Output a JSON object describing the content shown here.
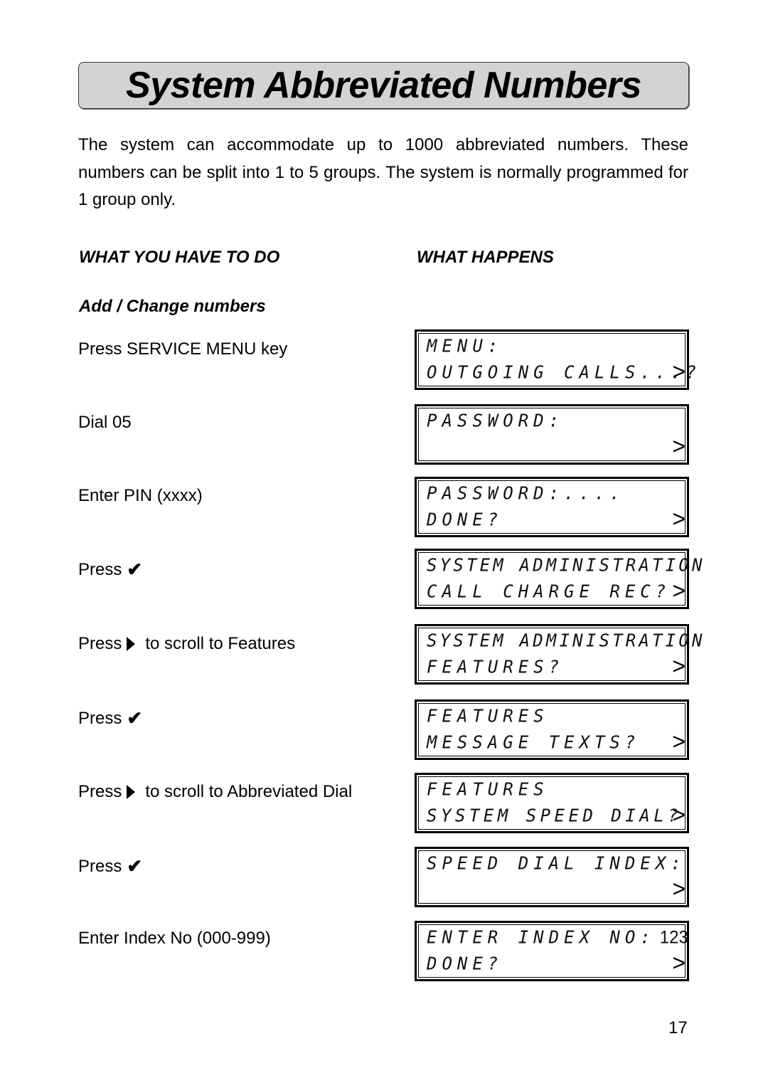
{
  "page": {
    "title": "System Abbreviated Numbers",
    "intro": "The system can accommodate up to 1000 abbreviated numbers. These numbers can be split into 1 to 5 groups. The system is normally programmed for 1 group only.",
    "col_left_heading": "WHAT YOU HAVE TO DO",
    "col_right_heading": "WHAT HAPPENS",
    "section_heading": "Add / Change numbers",
    "page_number": "17"
  },
  "steps": [
    {
      "text": "Press SERVICE MENU key",
      "icon": null,
      "after": ""
    },
    {
      "text": "Dial 05",
      "icon": null,
      "after": ""
    },
    {
      "text": "Enter PIN (xxxx)",
      "icon": null,
      "after": ""
    },
    {
      "text": "Press",
      "icon": "check-icon",
      "glyph": "✔",
      "after": ""
    },
    {
      "text": "Press",
      "icon": "right-triangle-icon",
      "after": "to scroll to Features"
    },
    {
      "text": "Press",
      "icon": "check-icon",
      "glyph": "✔",
      "after": ""
    },
    {
      "text": "Press",
      "icon": "right-triangle-icon",
      "after": "to scroll to Abbreviated Dial"
    },
    {
      "text": "Press",
      "icon": "check-icon",
      "glyph": "✔",
      "after": ""
    },
    {
      "text": "Enter Index No (000-999)",
      "icon": null,
      "after": ""
    }
  ],
  "displays": [
    {
      "line1": "MENU:",
      "line1_extra": "",
      "line2": "OUTGOING CALLS...?",
      "arrow": ">"
    },
    {
      "line1": "PASSWORD:",
      "line1_extra": "",
      "line2": "",
      "arrow": ">"
    },
    {
      "line1": "PASSWORD:....",
      "line1_extra": "",
      "line2": "DONE?",
      "arrow": ">"
    },
    {
      "line1": "SYSTEM ADMINISTRATION",
      "line1_extra": "",
      "line2": "CALL CHARGE REC?",
      "arrow": ">"
    },
    {
      "line1": "SYSTEM ADMINISTRATION",
      "line1_extra": "",
      "line2": "FEATURES?",
      "arrow": ">"
    },
    {
      "line1": "FEATURES",
      "line1_extra": "",
      "line2": "MESSAGE TEXTS?",
      "arrow": ">"
    },
    {
      "line1": "FEATURES",
      "line1_extra": "",
      "line2": "SYSTEM SPEED DIAL?",
      "arrow": ">"
    },
    {
      "line1": "SPEED DIAL INDEX:",
      "line1_extra": "",
      "line2": "",
      "arrow": ">"
    },
    {
      "line1": "ENTER INDEX NO:",
      "line1_extra": "123",
      "line2": "DONE?",
      "arrow": ">"
    }
  ]
}
